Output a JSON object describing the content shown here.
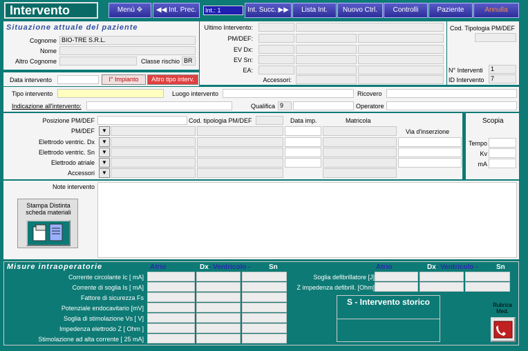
{
  "header": {
    "title": "Intervento"
  },
  "nav": {
    "menu": "Menù",
    "prev": "Int. Prec.",
    "int_field": "Int.: 1",
    "next": "Int. Succ.",
    "list": "Lista Int.",
    "new_ctrl": "Nuovo Ctrl.",
    "controls": "Controlli",
    "patient": "Paziente",
    "cancel": "Annulla"
  },
  "patient": {
    "section_title": "Situazione attuale del paziente",
    "surname_label": "Cognome",
    "surname": "BIO-TRE S.R.L.",
    "name_label": "Nome",
    "name": "",
    "other_surname_label": "Altro Cognome",
    "other_surname": "",
    "risk_class_label": "Classe rischio",
    "risk_class": "BR"
  },
  "last": {
    "last_label": "Ultimo Intervento:",
    "pmdef": "PM/DEF:",
    "evdx": "EV Dx:",
    "evsn": "EV Sn:",
    "ea": "EA:",
    "accessories": "Accessori:",
    "cod_tip_label": "Cod. Tipologia PM/DEF",
    "n_interventi_label": "N° Interventi",
    "n_interventi": "1",
    "id_label": "ID Intervento",
    "id": "7"
  },
  "intervention": {
    "date_label": "Data intervento",
    "first_implant": "I° Impianto",
    "other_type": "Altro tipo interv.",
    "type_label": "Tipo intervento",
    "place_label": "Luogo intervento",
    "recovery_label": "Ricovero",
    "indication_label": "Indicazione all'intervento:",
    "qualification_label": "Qualifica",
    "qualification": "9",
    "operator_label": "Operatore"
  },
  "position": {
    "position_label": "Posizione PM/DEF",
    "cod_tip_label": "Cod. tipologia PM/DEF",
    "date_imp_label": "Data imp.",
    "serial_label": "Matricola",
    "route_label": "Via d'inserzione",
    "rows": [
      "PM/DEF",
      "Elettrodo ventric. Dx",
      "Elettrodo ventric. Sn",
      "Elettrodo atriale",
      "Accessori"
    ],
    "notes_label": "Note intervento"
  },
  "scopia": {
    "title": "Scopia",
    "time": "Tempo",
    "kv": "Kv",
    "ma": "mA"
  },
  "print_btn": "Stampa Distinta scheda materiali",
  "measures": {
    "title": "Misure intraoperatorie",
    "atrio": "Atrio",
    "dx": "Dx",
    "ventricolo": "- Ventricolo -",
    "sn": "Sn",
    "rows": [
      "Corrente circolante Ic [ mA]",
      "Corrente di soglia Is [ mA]",
      "Fattore di sicurezza Fs",
      "Potenziale endocavitario [mV]",
      "Soglia di stimolazione Vs [ V]",
      "Impedenza elettrodo Z [ Ohm ]",
      "Stimolazione ad alta corrente [ 25 mA]"
    ],
    "defib_threshold": "Soglia defibrillatore [J]",
    "defib_impedance": "Z impedenza defibrill. [Ohm]"
  },
  "history": {
    "title": "S - Intervento storico"
  },
  "rubrica": {
    "label": "Rubrica Med."
  }
}
